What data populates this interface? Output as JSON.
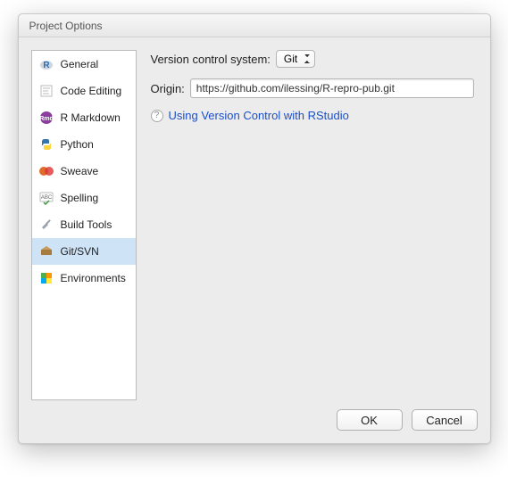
{
  "window": {
    "title": "Project Options"
  },
  "sidebar": {
    "items": [
      {
        "label": "General"
      },
      {
        "label": "Code Editing"
      },
      {
        "label": "R Markdown"
      },
      {
        "label": "Python"
      },
      {
        "label": "Sweave"
      },
      {
        "label": "Spelling"
      },
      {
        "label": "Build Tools"
      },
      {
        "label": "Git/SVN"
      },
      {
        "label": "Environments"
      }
    ]
  },
  "main": {
    "vcs_label": "Version control system:",
    "vcs_value": "Git",
    "origin_label": "Origin:",
    "origin_value": "https://github.com/ilessing/R-repro-pub.git",
    "help_link": "Using Version Control with RStudio"
  },
  "footer": {
    "ok": "OK",
    "cancel": "Cancel"
  }
}
